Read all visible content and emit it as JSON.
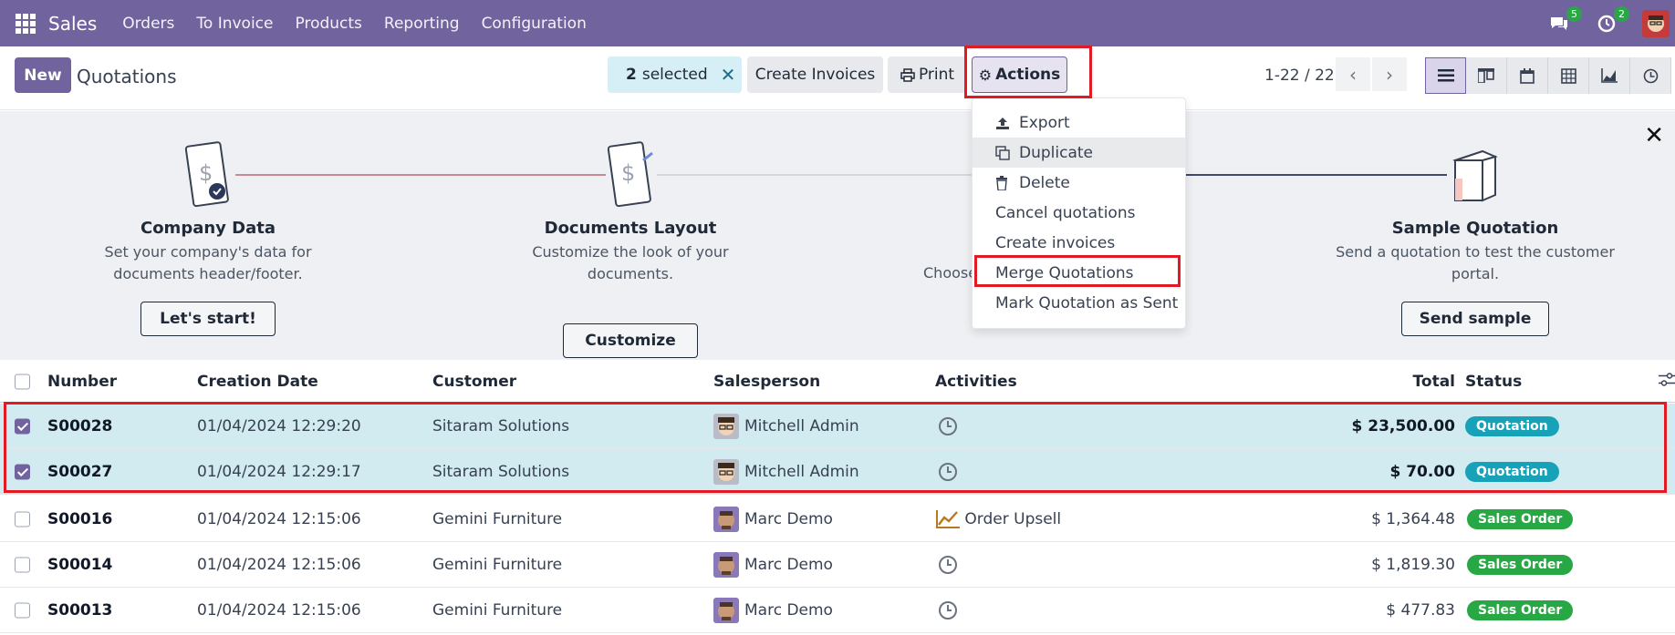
{
  "nav": {
    "app": "Sales",
    "items": [
      "Orders",
      "To Invoice",
      "Products",
      "Reporting",
      "Configuration"
    ],
    "chat_count": "5",
    "activity_count": "2"
  },
  "control": {
    "new_label": "New",
    "title": "Quotations",
    "selected_count": "2",
    "selected_label": "selected",
    "create_invoices": "Create Invoices",
    "print": "Print",
    "actions": "Actions",
    "pager": "1-22 / 22"
  },
  "onboarding": {
    "steps": [
      {
        "title": "Company Data",
        "desc": "Set your company's data for documents header/footer.",
        "button": "Let's start!"
      },
      {
        "title": "Documents Layout",
        "desc": "Customize the look of your documents.",
        "button": "Customize"
      },
      {
        "title": "",
        "desc": "Choose",
        "button": ""
      },
      {
        "title": "Sample Quotation",
        "desc": "Send a quotation to test the customer portal.",
        "button": "Send sample"
      }
    ]
  },
  "actions_menu": {
    "items": [
      {
        "label": "Export",
        "icon": "upload-icon"
      },
      {
        "label": "Duplicate",
        "icon": "copy-icon"
      },
      {
        "label": "Delete",
        "icon": "trash-icon"
      },
      {
        "label": "Cancel quotations",
        "icon": ""
      },
      {
        "label": "Create invoices",
        "icon": ""
      },
      {
        "label": "Merge Quotations",
        "icon": ""
      },
      {
        "label": "Mark Quotation as Sent",
        "icon": ""
      }
    ]
  },
  "table": {
    "columns": {
      "number": "Number",
      "date": "Creation Date",
      "customer": "Customer",
      "salesperson": "Salesperson",
      "activities": "Activities",
      "total": "Total",
      "status": "Status"
    },
    "rows": [
      {
        "number": "S00028",
        "date": "01/04/2024 12:29:20",
        "customer": "Sitaram Solutions",
        "salesperson": "Mitchell Admin",
        "activity": "",
        "total": "$ 23,500.00",
        "status": "Quotation",
        "selected": true
      },
      {
        "number": "S00027",
        "date": "01/04/2024 12:29:17",
        "customer": "Sitaram Solutions",
        "salesperson": "Mitchell Admin",
        "activity": "",
        "total": "$ 70.00",
        "status": "Quotation",
        "selected": true
      },
      {
        "number": "S00016",
        "date": "01/04/2024 12:15:06",
        "customer": "Gemini Furniture",
        "salesperson": "Marc Demo",
        "activity": "Order Upsell",
        "total": "$ 1,364.48",
        "status": "Sales Order",
        "selected": false
      },
      {
        "number": "S00014",
        "date": "01/04/2024 12:15:06",
        "customer": "Gemini Furniture",
        "salesperson": "Marc Demo",
        "activity": "",
        "total": "$ 1,819.30",
        "status": "Sales Order",
        "selected": false
      },
      {
        "number": "S00013",
        "date": "01/04/2024 12:15:06",
        "customer": "Gemini Furniture",
        "salesperson": "Marc Demo",
        "activity": "",
        "total": "$ 477.83",
        "status": "Sales Order",
        "selected": false
      }
    ]
  },
  "colors": {
    "brand": "#71639e",
    "highlight": "#e01b24",
    "quotation": "#17a2b8",
    "sales_order": "#28a745"
  }
}
